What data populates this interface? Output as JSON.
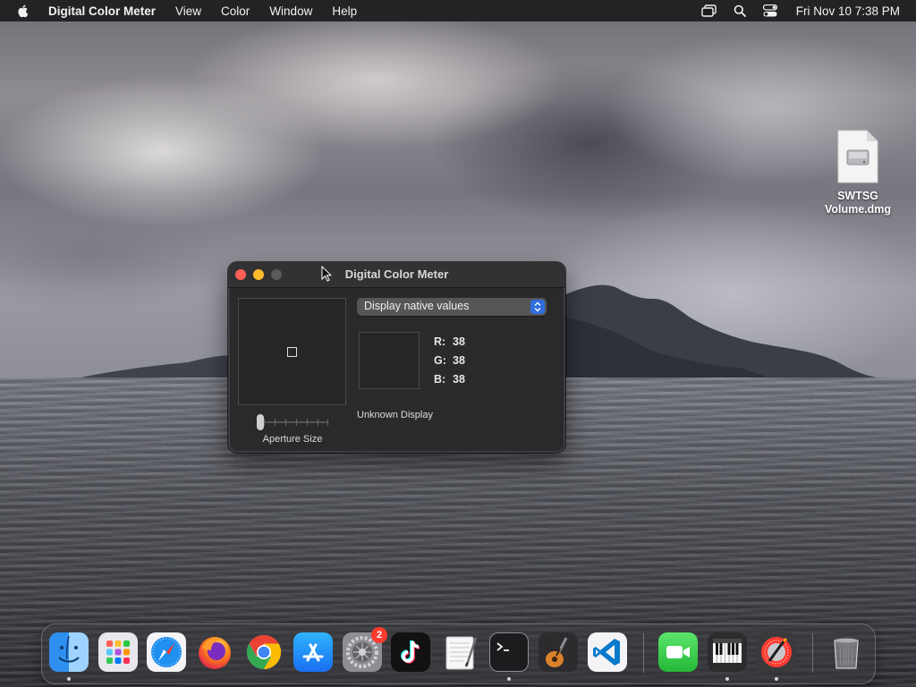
{
  "menubar": {
    "app_name": "Digital Color Meter",
    "items": [
      "View",
      "Color",
      "Window",
      "Help"
    ],
    "clock": "Fri Nov 10  7:38 PM"
  },
  "desktop": {
    "file_label": "SWTSG Volume.dmg"
  },
  "window": {
    "title": "Digital Color Meter",
    "popup_value": "Display native values",
    "values": [
      {
        "label": "R:",
        "value": "38"
      },
      {
        "label": "G:",
        "value": "38"
      },
      {
        "label": "B:",
        "value": "38"
      }
    ],
    "display_label": "Unknown Display",
    "aperture_label": "Aperture Size",
    "aperture_level": 0,
    "sample_color": "#262626"
  },
  "dock": {
    "apps": [
      "Finder",
      "Launchpad",
      "Safari",
      "Firefox",
      "Chrome",
      "App Store",
      "System Settings",
      "TikTok",
      "TextEdit",
      "Terminal",
      "GarageBand",
      "Visual Studio Code",
      "FaceTime",
      "Piano",
      "Digital Color Meter",
      "Trash"
    ],
    "settings_badge": "2"
  },
  "colors": {
    "close": "#ff5f57",
    "minimize": "#febc2e",
    "accent": "#2f6fe0",
    "window_bg": "#2a2a2c"
  }
}
